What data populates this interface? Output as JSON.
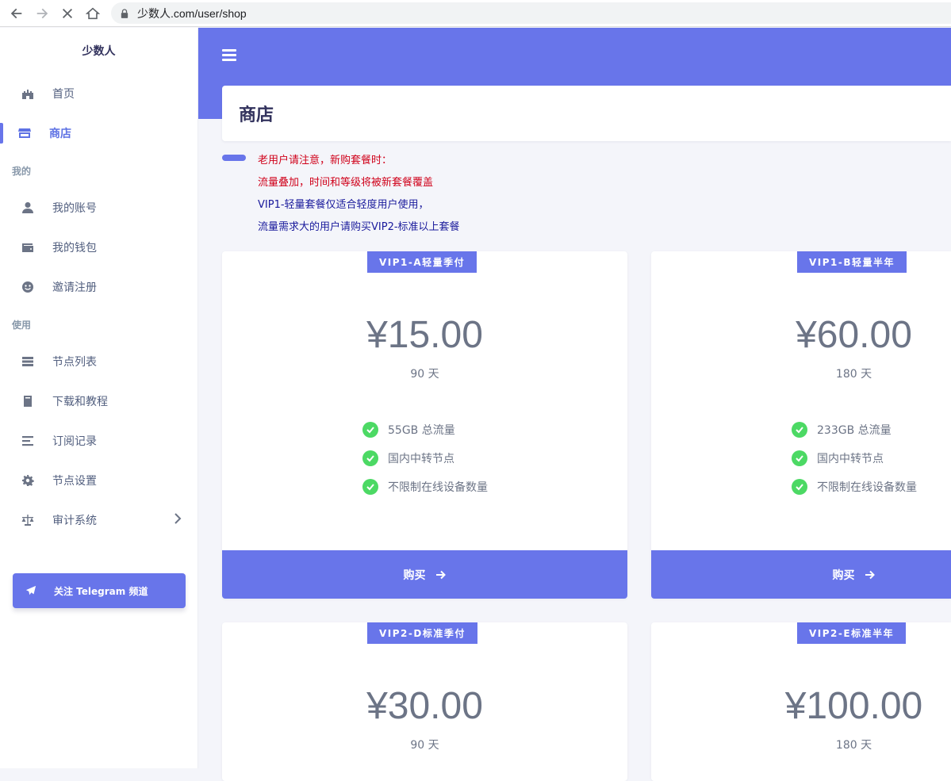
{
  "browser": {
    "url": "少数人.com/user/shop"
  },
  "sidebar": {
    "brand": "少数人",
    "items_top": [
      {
        "label": "首页",
        "icon": "castle-icon"
      },
      {
        "label": "商店",
        "icon": "store-icon",
        "active": true
      }
    ],
    "section_mine": "我的",
    "items_mine": [
      {
        "label": "我的账号",
        "icon": "user-icon"
      },
      {
        "label": "我的钱包",
        "icon": "wallet-icon"
      },
      {
        "label": "邀请注册",
        "icon": "smile-icon"
      }
    ],
    "section_use": "使用",
    "items_use": [
      {
        "label": "节点列表",
        "icon": "server-icon"
      },
      {
        "label": "下载和教程",
        "icon": "book-icon"
      },
      {
        "label": "订阅记录",
        "icon": "list-icon"
      },
      {
        "label": "节点设置",
        "icon": "gear-icon"
      },
      {
        "label": "审计系统",
        "icon": "balance-icon"
      }
    ],
    "telegram_button": "关注 Telegram 频道"
  },
  "page": {
    "title": "商店",
    "notice": {
      "line1": "老用户请注意，新购套餐时：",
      "line2": "流量叠加，时间和等级将被新套餐覆盖",
      "line3": "VIP1-轻量套餐仅适合轻度用户使用，",
      "line4": "流量需求大的用户请购买VIP2-标准以上套餐"
    }
  },
  "plans": [
    {
      "name": "VIP1-A轻量季付",
      "price": "¥15.00",
      "duration": "90 天",
      "features": [
        "55GB 总流量",
        "国内中转节点",
        "不限制在线设备数量"
      ],
      "buy_label": "购买"
    },
    {
      "name": "VIP1-B轻量半年",
      "price": "¥60.00",
      "duration": "180 天",
      "features": [
        "233GB 总流量",
        "国内中转节点",
        "不限制在线设备数量"
      ],
      "buy_label": "购买"
    },
    {
      "name": "VIP2-D标准季付",
      "price": "¥30.00",
      "duration": "90 天"
    },
    {
      "name": "VIP2-E标准半年",
      "price": "¥100.00",
      "duration": "180 天"
    }
  ],
  "colors": {
    "accent": "#6875ea",
    "check": "#4cd964",
    "notice_red": "#d0021b",
    "notice_blue": "#1a1a9c"
  }
}
